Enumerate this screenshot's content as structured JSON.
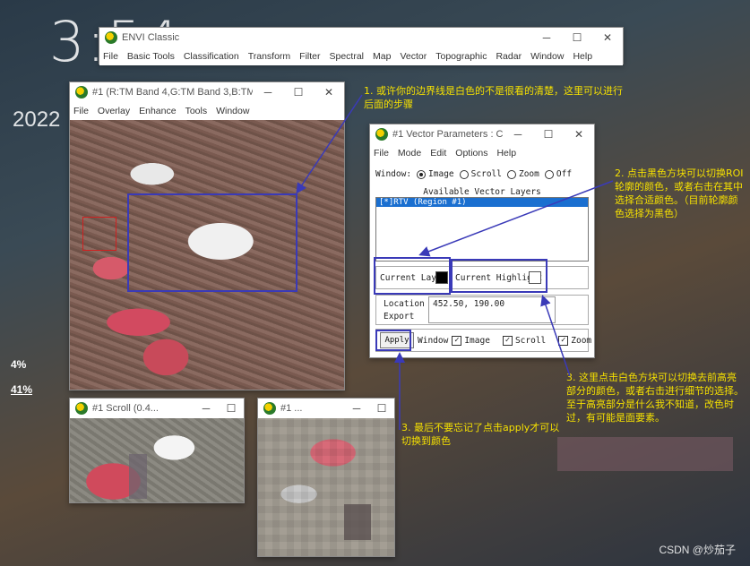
{
  "desktop": {
    "clock": "3:54",
    "year": "2022",
    "stat1": "4%",
    "stat2": "41%",
    "watermark": "CSDN @炒茄子"
  },
  "envi_main": {
    "title": "ENVI Classic",
    "menu": [
      "File",
      "Basic Tools",
      "Classification",
      "Transform",
      "Filter",
      "Spectral",
      "Map",
      "Vector",
      "Topographic",
      "Radar",
      "Window",
      "Help"
    ]
  },
  "image_window": {
    "title": "#1 (R:TM Band 4,G:TM Band 3,B:TM B...",
    "menu": [
      "File",
      "Overlay",
      "Enhance",
      "Tools",
      "Window"
    ]
  },
  "vector_params": {
    "title": "#1 Vector Parameters : C...",
    "menu": [
      "File",
      "Mode",
      "Edit",
      "Options",
      "Help"
    ],
    "window_label": "Window:",
    "radio_options": [
      "Image",
      "Scroll",
      "Zoom",
      "Off"
    ],
    "radio_selected": "Image",
    "available_layers_label": "Available Vector Layers",
    "layers": [
      "[*]RTV (Region #1)"
    ],
    "current_layer_label": "Current Layer",
    "current_layer_color": "#000000",
    "current_highlight_label": "Current Highlight",
    "current_highlight_color": "#ffffff",
    "location_label": "Location",
    "location_value": "452.50, 190.00",
    "export_label": "Export",
    "apply_label": "Apply",
    "window_checks_label": "Window",
    "checks": [
      "Image",
      "Scroll",
      "Zoom"
    ]
  },
  "scroll_window": {
    "title": "#1 Scroll (0.4..."
  },
  "zoom_window": {
    "title": "#1 ..."
  },
  "annotations": {
    "a1": "1. 或许你的边界线是白色的不是很看的清楚，这里可以进行后面的步骤",
    "a2": "2. 点击黑色方块可以切换ROI轮廓的颜色，或者右击在其中选择合适颜色。（目前轮廓颜色选择为黑色）",
    "a3": "3. 这里点击白色方块可以切换去前高亮部分的颜色，或者右击进行细节的选择。至于高亮部分是什么我不知道，改色时过，有可能是面要素。",
    "a4": "3. 最后不要忘记了点击apply才可以切换到颜色"
  },
  "colors": {
    "annotation": "#f5e000",
    "highlight_box": "#3a3ab8",
    "selection": "#1a6fd0"
  }
}
